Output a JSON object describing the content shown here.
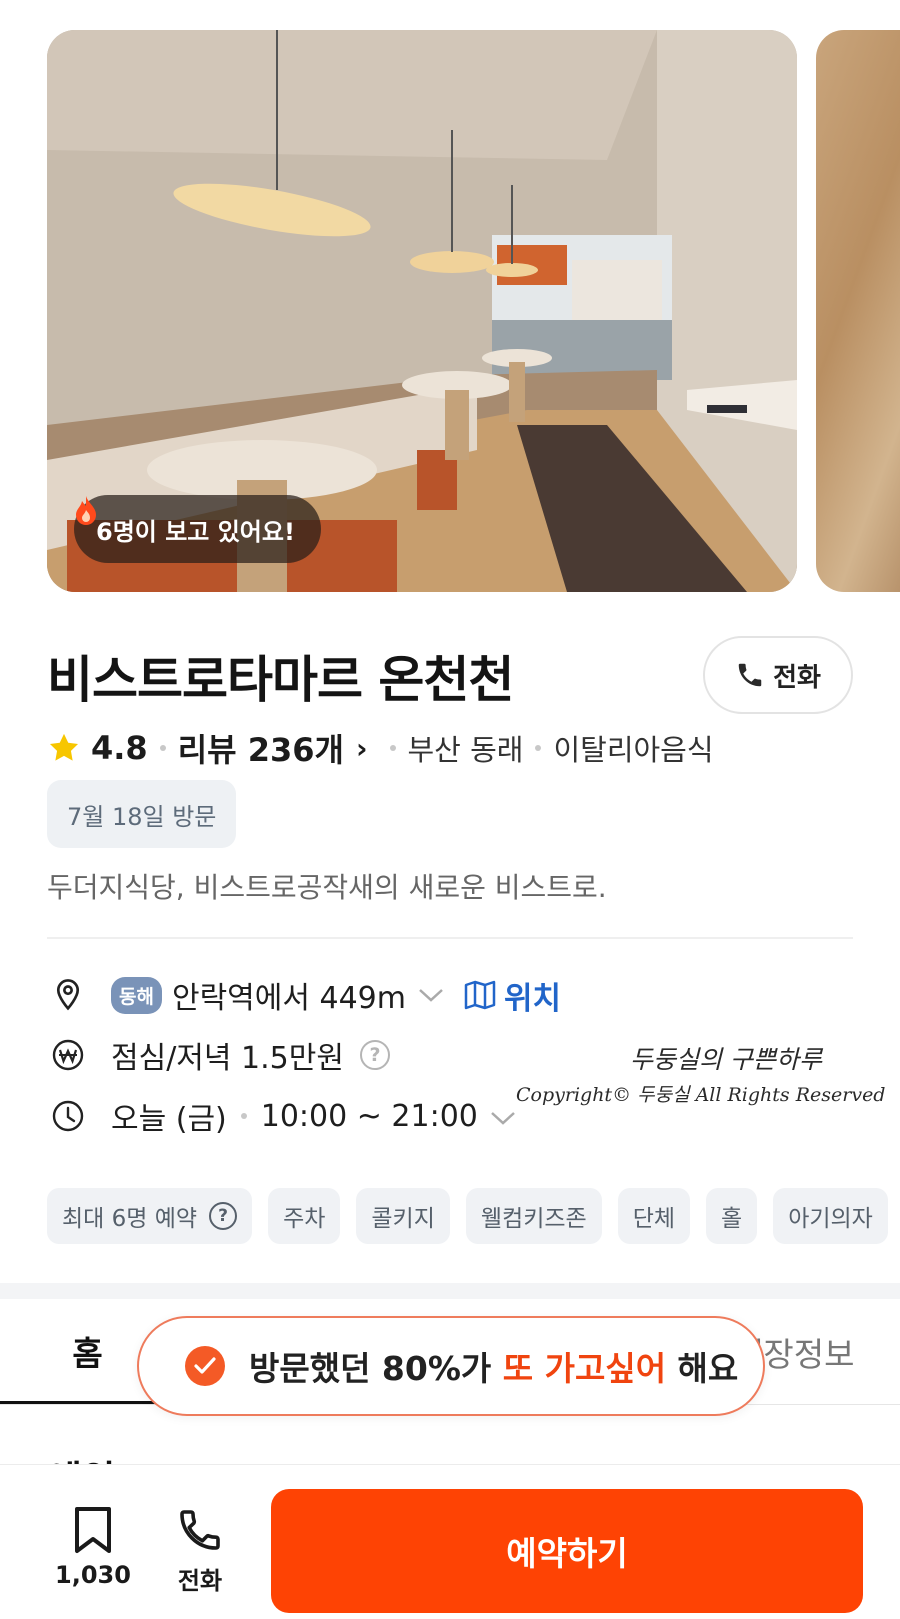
{
  "photo": {
    "viewers_text": "6명이 보고 있어요!"
  },
  "restaurant": {
    "name": "비스트로타마르 온천천",
    "call_label": "전화",
    "rating": "4.8",
    "review_label": "리뷰 236개",
    "location": "부산 동래",
    "category": "이탈리아음식",
    "visit_chip": "7월 18일 방문",
    "description": "두더지식당, 비스트로공작새의 새로운 비스트로."
  },
  "info": {
    "area_badge": "동해",
    "distance": "안락역에서 449m",
    "map_link": "위치",
    "price": "점심/저녁 1.5만원",
    "hours_day": "오늘 (금)",
    "hours_time": "10:00 ~ 21:00"
  },
  "watermark": {
    "line1": "두둥실의 구쁜하루",
    "line2": "Copyright© 두둥실 All Rights Reserved"
  },
  "tags": [
    "최대 6명 예약",
    "주차",
    "콜키지",
    "웰컴키즈존",
    "단체",
    "홀",
    "아기의자"
  ],
  "tabs": {
    "home": "홈",
    "store_info": "매장정보"
  },
  "section_peek": "예약",
  "toast": {
    "prefix": "방문했던 80%가 ",
    "highlight": "또 가고싶어",
    "suffix": " 해요"
  },
  "bottom_bar": {
    "bookmark_count": "1,030",
    "call_label": "전화",
    "reserve_label": "예약하기"
  },
  "colors": {
    "accent": "#fe4304",
    "link": "#2165c9",
    "star": "#f7c600"
  }
}
